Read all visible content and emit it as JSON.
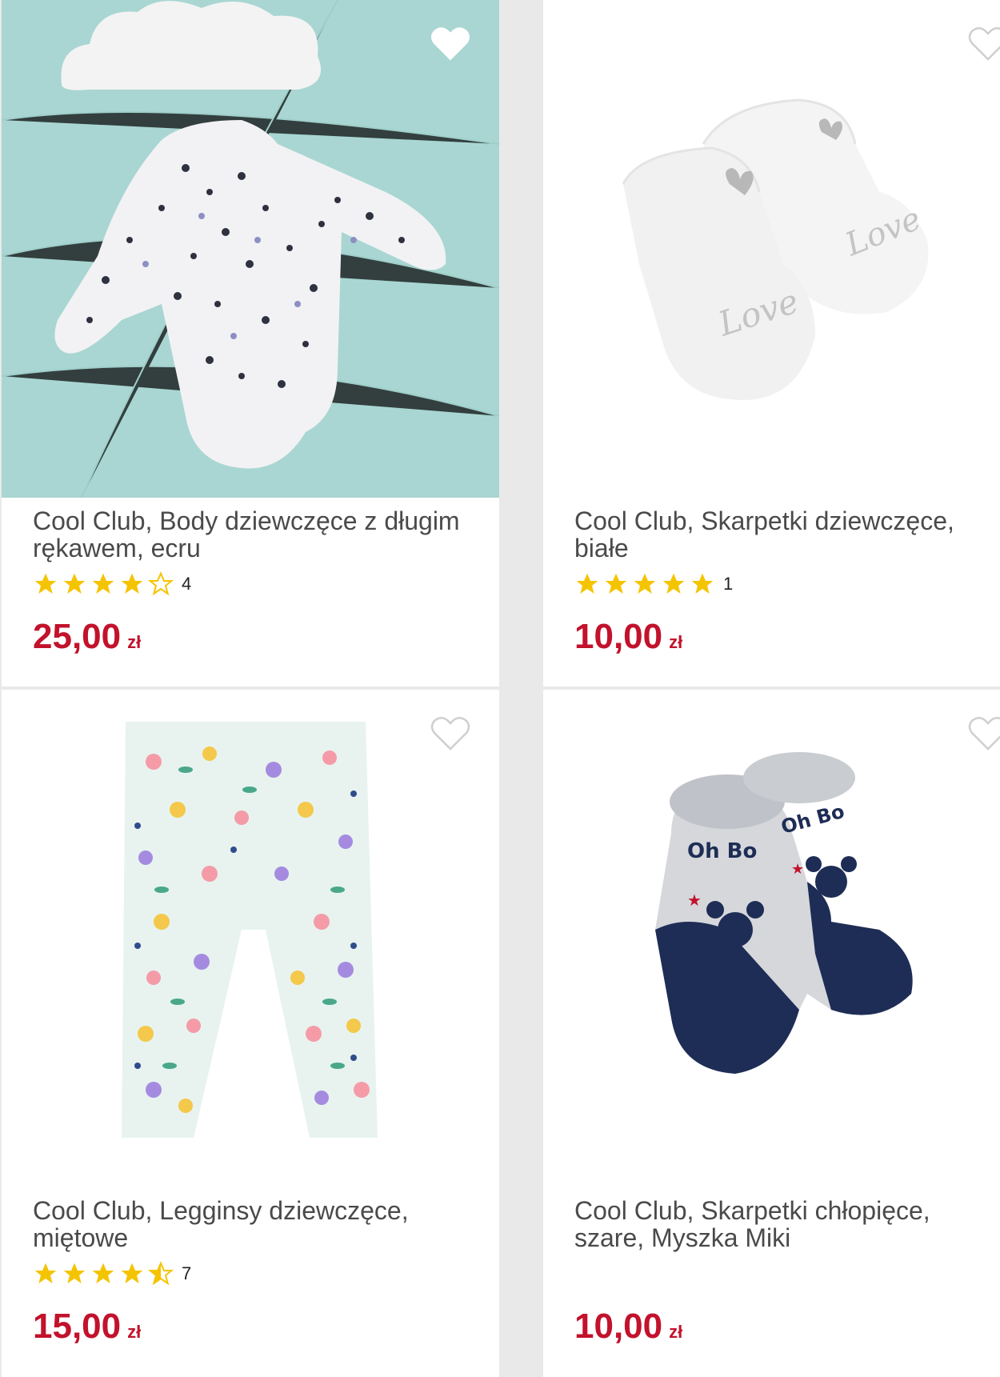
{
  "colors": {
    "price": "#c2122c",
    "star": "#f5c400",
    "accent_bg": "#a9d6d2"
  },
  "products": [
    {
      "title": "Cool Club, Body dziewczęce z długim rękawem, ecru",
      "rating": 4,
      "rating_count": "4",
      "price": "25,00",
      "currency": "zł",
      "favorite_icon": "heart-icon",
      "image": "bodysuit-photo"
    },
    {
      "title": "Cool Club, Skarpetki dziewczęce, białe",
      "rating": 5,
      "rating_count": "1",
      "price": "10,00",
      "currency": "zł",
      "favorite_icon": "heart-outline-icon",
      "image": "white-socks-photo"
    },
    {
      "title": "Cool Club, Legginsy dziewczęce, miętowe",
      "rating": 4.5,
      "rating_count": "7",
      "price": "15,00",
      "currency": "zł",
      "favorite_icon": "heart-outline-icon",
      "image": "leggings-photo"
    },
    {
      "title": "Cool Club, Skarpetki chłopięce, szare, Myszka Miki",
      "rating": null,
      "rating_count": "",
      "price": "10,00",
      "currency": "zł",
      "favorite_icon": "heart-outline-icon",
      "image": "mickey-socks-photo"
    }
  ]
}
